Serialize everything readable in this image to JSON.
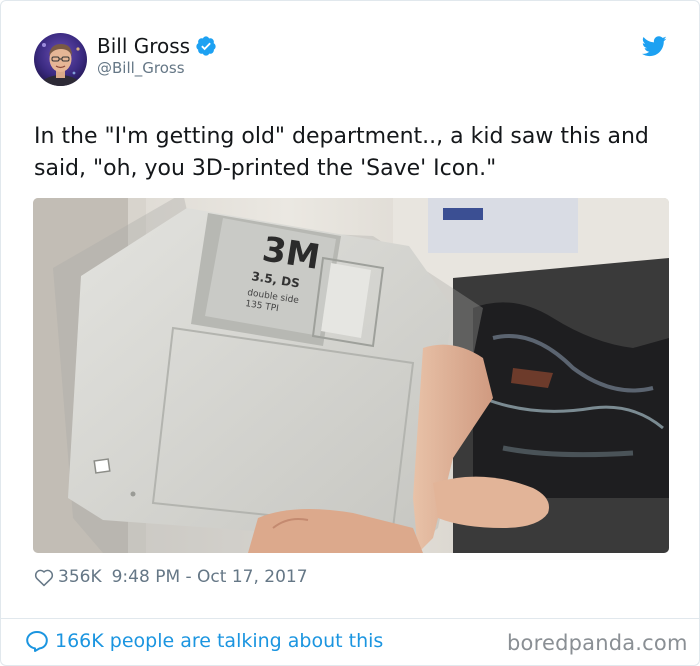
{
  "user": {
    "display_name": "Bill Gross",
    "handle": "@Bill_Gross",
    "avatar_icon": "avatar-photo-icon",
    "verified_icon": "verified-badge-icon"
  },
  "tweet": {
    "text": "In the \"I'm getting old\" department.., a kid saw this and said, \"oh, you 3D-printed the 'Save' Icon.\""
  },
  "photo": {
    "disk_brand": "3M",
    "disk_label_line1": "3.5, DS",
    "disk_label_line2": "double side",
    "disk_label_line3": "135 TPI"
  },
  "meta": {
    "likes": "356K",
    "timestamp": "9:48 PM - Oct 17, 2017",
    "heart_icon": "heart-icon"
  },
  "footer": {
    "talking": "166K people are talking about this",
    "bubble_icon": "speech-bubble-icon",
    "watermark": "boredpanda.com"
  },
  "colors": {
    "twitter_blue": "#1da1f2",
    "link_blue": "#1b95e0",
    "secondary_text": "#657786",
    "primary_text": "#14171a"
  }
}
